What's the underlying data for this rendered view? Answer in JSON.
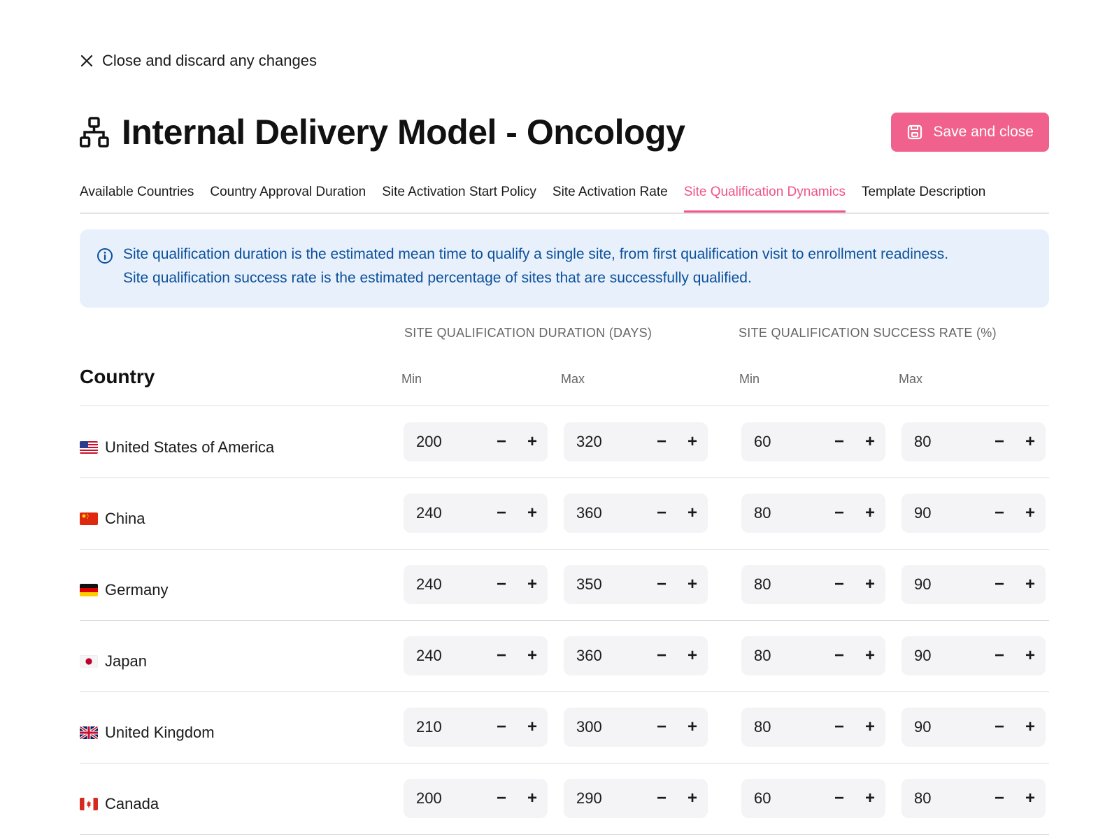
{
  "close": {
    "label": "Close and discard any changes"
  },
  "header": {
    "title": "Internal Delivery Model - Oncology",
    "save_label": "Save and close"
  },
  "tabs": [
    {
      "label": "Available Countries",
      "active": false
    },
    {
      "label": "Country Approval Duration",
      "active": false
    },
    {
      "label": "Site Activation Start Policy",
      "active": false
    },
    {
      "label": "Site Activation Rate",
      "active": false
    },
    {
      "label": "Site Qualification Dynamics",
      "active": true
    },
    {
      "label": "Template Description",
      "active": false
    }
  ],
  "info": {
    "line1": "Site qualification duration is the estimated mean time to qualify a single site, from first qualification visit to enrollment readiness.",
    "line2": "Site qualification success rate is the estimated percentage of sites that are successfully qualified."
  },
  "table": {
    "country_header": "Country",
    "group_duration": "SITE QUALIFICATION DURATION (DAYS)",
    "group_success": "SITE QUALIFICATION SUCCESS RATE (%)",
    "min_label": "Min",
    "max_label": "Max",
    "minus": "−",
    "plus": "+",
    "rows": [
      {
        "country": "United States of America",
        "flag": "us-flag",
        "dur_min": "200",
        "dur_max": "320",
        "rate_min": "60",
        "rate_max": "80"
      },
      {
        "country": "China",
        "flag": "cn-flag",
        "dur_min": "240",
        "dur_max": "360",
        "rate_min": "80",
        "rate_max": "90"
      },
      {
        "country": "Germany",
        "flag": "de-flag",
        "dur_min": "240",
        "dur_max": "350",
        "rate_min": "80",
        "rate_max": "90"
      },
      {
        "country": "Japan",
        "flag": "jp-flag",
        "dur_min": "240",
        "dur_max": "360",
        "rate_min": "80",
        "rate_max": "90"
      },
      {
        "country": "United Kingdom",
        "flag": "gb-flag",
        "dur_min": "210",
        "dur_max": "300",
        "rate_min": "80",
        "rate_max": "90"
      },
      {
        "country": "Canada",
        "flag": "ca-flag",
        "dur_min": "200",
        "dur_max": "290",
        "rate_min": "60",
        "rate_max": "80"
      }
    ]
  },
  "colors": {
    "accent": "#ef5586",
    "info_bg": "#e8f1fb",
    "info_text": "#0b4f9c",
    "stepper_bg": "#f4f3f6"
  }
}
